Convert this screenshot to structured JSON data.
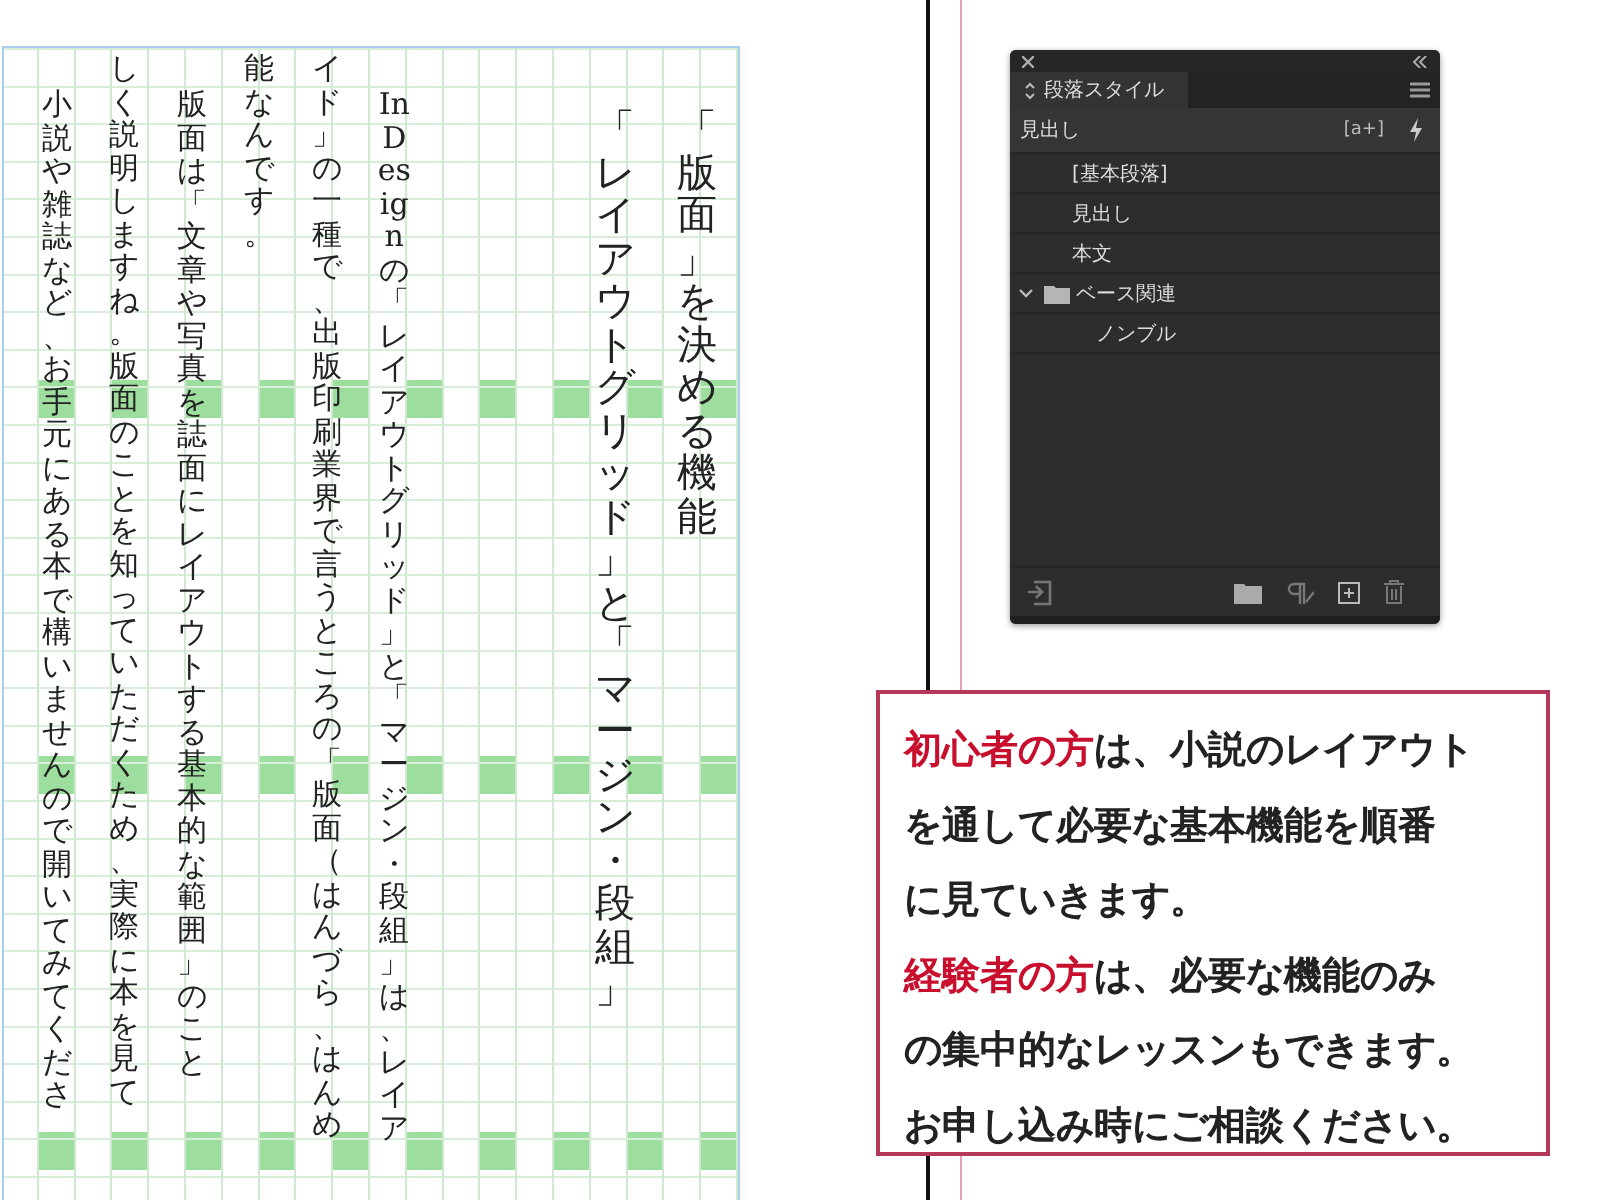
{
  "document": {
    "title_lines": [
      "「レイアウトグリッド」と「マージン・段組」",
      "「版面」を決める機能"
    ],
    "body_columns": [
      {
        "text": "小説や雑誌など、お手元にある本で構いませんので開いてみてくださ",
        "indent": true
      },
      {
        "text": "しく説明しますね。版面のことを知っていただくため、実際に本を見て",
        "indent": false
      },
      {
        "text": "版面は「文章や写真を誌面にレイアウトする基本的な範囲」のこと",
        "indent": true
      },
      {
        "text": "能なんです。",
        "indent": false
      },
      {
        "text": "イド」の一種で、出版印刷業界で言うところの「版面（はんづら、はんめ",
        "indent": false
      },
      {
        "text": "InDesign の「レイアウトグリッド」と「マージン・段組」は、レイア",
        "indent": true
      }
    ]
  },
  "panel": {
    "tab": "段落スタイル",
    "current_style": "見出し",
    "new_style_label": "[a+]",
    "styles": [
      {
        "kind": "style",
        "label": "[基本段落]"
      },
      {
        "kind": "style",
        "label": "見出し"
      },
      {
        "kind": "style",
        "label": "本文"
      },
      {
        "kind": "group",
        "label": "ベース関連",
        "expanded": true,
        "children": [
          {
            "kind": "style",
            "label": "ノンブル"
          }
        ]
      }
    ]
  },
  "callout": {
    "paragraphs": [
      [
        "**初心者の方**は、小説のレイアウト",
        "を通して必要な基本機能を順番",
        "に見ていきます。"
      ],
      [
        "**経験者の方**は、必要な機能のみ",
        "の集中的なレッスンもできます。",
        "お申し込み時にご相談ください。"
      ]
    ]
  }
}
